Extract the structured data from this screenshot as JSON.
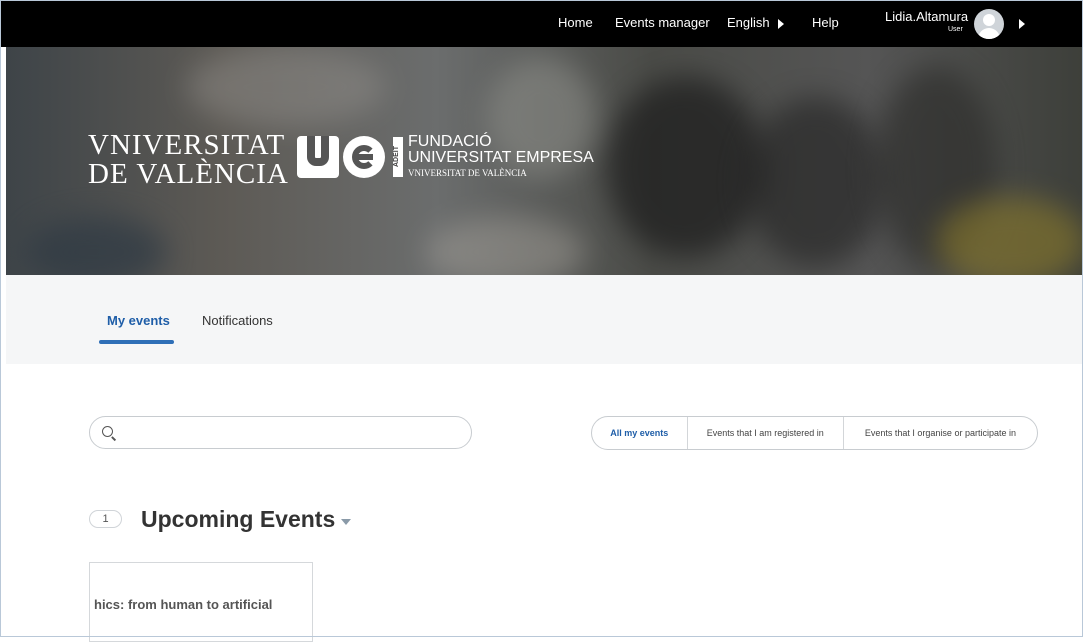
{
  "topbar": {
    "nav": [
      "Home",
      "Events manager",
      "English",
      "Help"
    ],
    "user_name": "Lidia.Altamura",
    "user_role": "User"
  },
  "banner": {
    "uv_line1": "VNIVERSITAT",
    "uv_line2": "DE VALÈNCIA",
    "adeit": "ADEIT",
    "fund_line1": "FUNDACIÓ",
    "fund_line2": "UNIVERSITAT EMPRESA",
    "fund_line3": "VNIVERSITAT DE VALÈNCIA"
  },
  "tabs": [
    {
      "label": "My events",
      "active": true
    },
    {
      "label": "Notifications",
      "active": false
    }
  ],
  "search": {
    "value": "",
    "placeholder": ""
  },
  "filters": [
    {
      "label": "All my events",
      "active": true
    },
    {
      "label": "Events that I am registered in",
      "active": false
    },
    {
      "label": "Events that I organise or participate in",
      "active": false
    }
  ],
  "upcoming": {
    "count": "1",
    "title": "Upcoming Events"
  },
  "events": [
    {
      "title": "hics: from human to artificial"
    }
  ],
  "colors": {
    "accent": "#1f5ea8",
    "underline": "#2f6fb7",
    "topbar": "#000000",
    "tabs_bg": "#f5f6f7"
  }
}
